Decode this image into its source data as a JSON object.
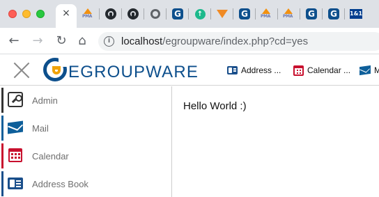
{
  "browser": {
    "active_tab": {
      "close_glyph": "×",
      "icon": "close-icon"
    },
    "pinned_tabs": [
      {
        "icon": "phpmyadmin-favicon",
        "text": "PMA"
      },
      {
        "icon": "github-favicon"
      },
      {
        "icon": "github-favicon"
      },
      {
        "icon": "globe-favicon"
      },
      {
        "icon": "egroupware-favicon",
        "text": "G"
      },
      {
        "icon": "green-shield-favicon",
        "text": "↑"
      },
      {
        "icon": "fox-favicon"
      },
      {
        "icon": "egroupware-favicon",
        "text": "G"
      },
      {
        "icon": "phpmyadmin-favicon",
        "text": "PMA"
      },
      {
        "icon": "phpmyadmin-favicon",
        "text": "PMA"
      },
      {
        "icon": "egroupware-favicon",
        "text": "G"
      },
      {
        "icon": "egroupware-favicon",
        "text": "G"
      },
      {
        "icon": "1and1-favicon",
        "text": "1&1"
      }
    ],
    "nav": {
      "back": "←",
      "forward": "→",
      "reload": "↻",
      "home": "⌂"
    },
    "address": {
      "host": "localhost",
      "path": "/egroupware/index.php?cd=yes",
      "info_glyph": "i"
    }
  },
  "app": {
    "logo_text": "EGROUPWARE",
    "quick_links": [
      {
        "label": "Address ...",
        "icon": "addressbook-icon"
      },
      {
        "label": "Calendar ...",
        "icon": "calendar-icon"
      },
      {
        "label": "M",
        "icon": "mail-icon"
      }
    ],
    "sidebar": [
      {
        "label": "Admin",
        "icon": "admin-icon",
        "color": "#333333"
      },
      {
        "label": "Mail",
        "icon": "mail-icon",
        "color": "#0e5f9a"
      },
      {
        "label": "Calendar",
        "icon": "calendar-icon",
        "color": "#c8102e"
      },
      {
        "label": "Address Book",
        "icon": "addressbook-icon",
        "color": "#1a4f8b"
      }
    ],
    "content": {
      "text": "Hello World :)"
    }
  },
  "colors": {
    "brand_blue": "#0d4f8c",
    "brand_gold": "#f0a30a",
    "tabstrip_bg": "#dee1e6"
  }
}
